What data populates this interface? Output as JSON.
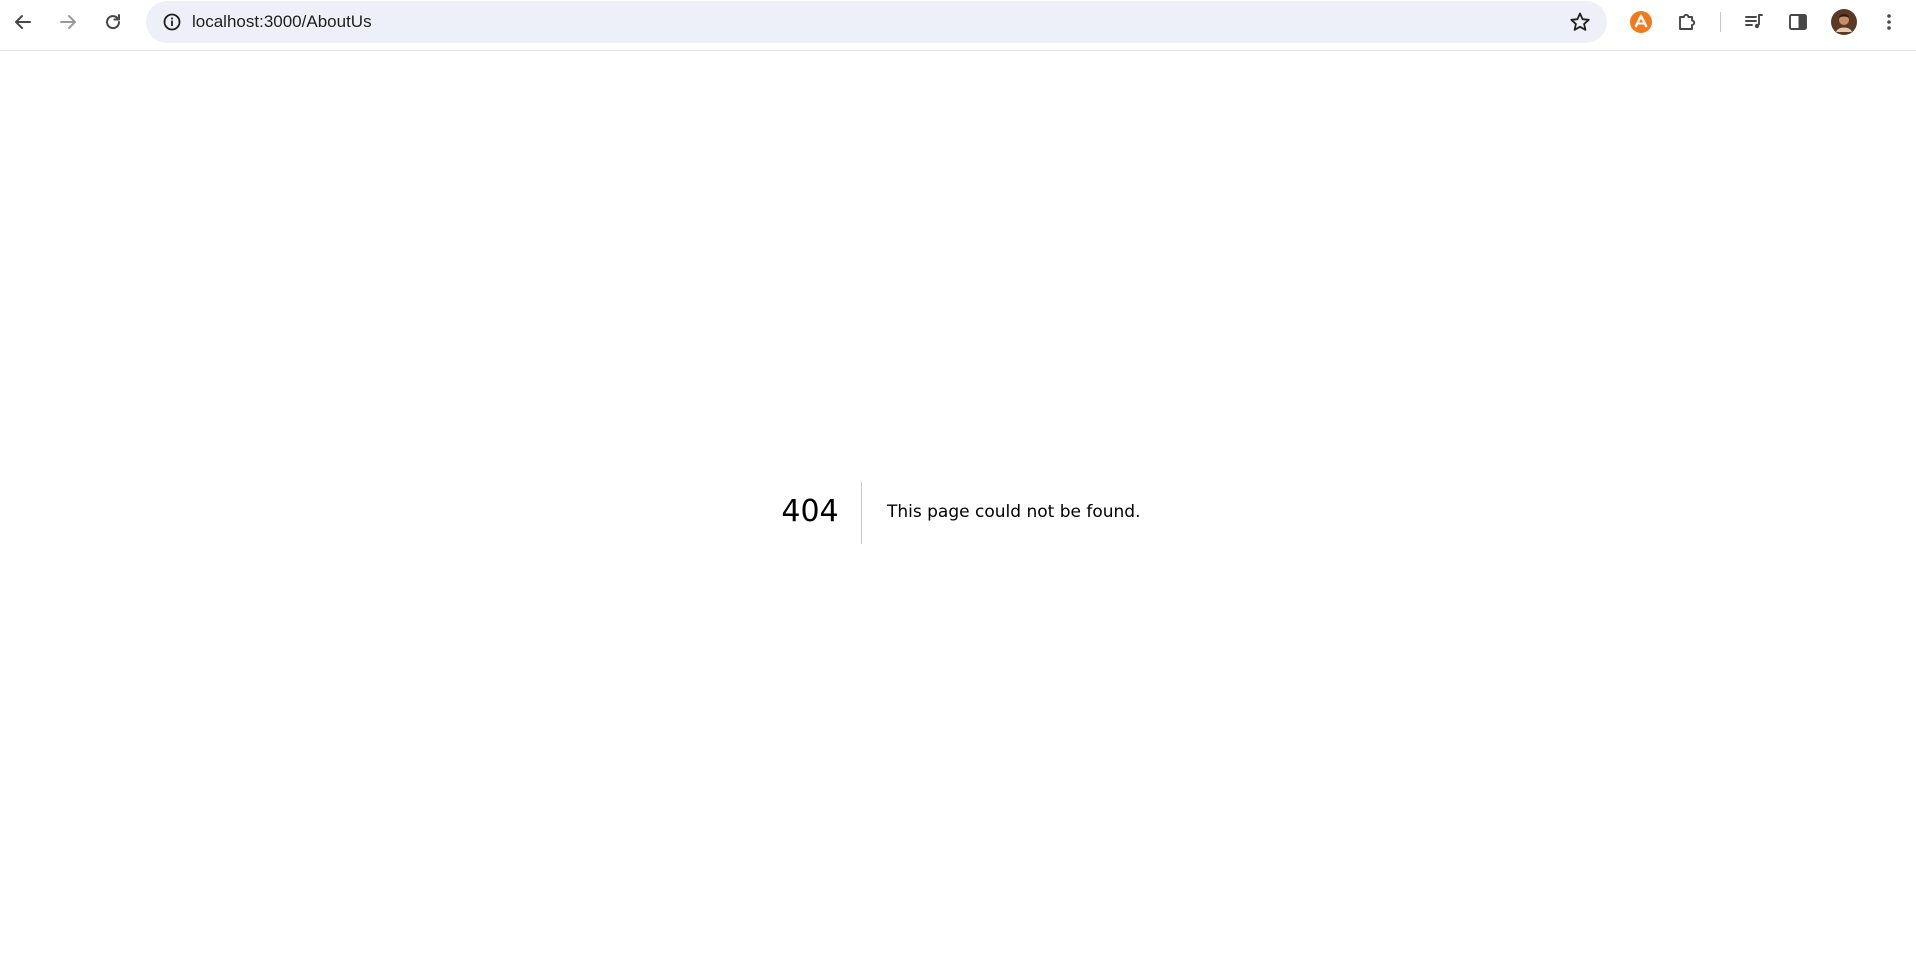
{
  "browser": {
    "url": "localhost:3000/AboutUs",
    "icons": {
      "back": "arrow-left-icon",
      "forward": "arrow-right-icon",
      "reload": "reload-icon",
      "site_info": "info-icon",
      "bookmark": "star-icon",
      "extension_1": "orange-extension-icon",
      "extensions": "puzzle-icon",
      "media": "media-queue-icon",
      "side_panel": "side-panel-icon",
      "profile": "avatar",
      "menu": "kebab-menu-icon"
    },
    "colors": {
      "omnibox_bg": "#edf0f8",
      "extension_orange": "#f27a1a"
    }
  },
  "page": {
    "error_code": "404",
    "error_message": "This page could not be found."
  }
}
